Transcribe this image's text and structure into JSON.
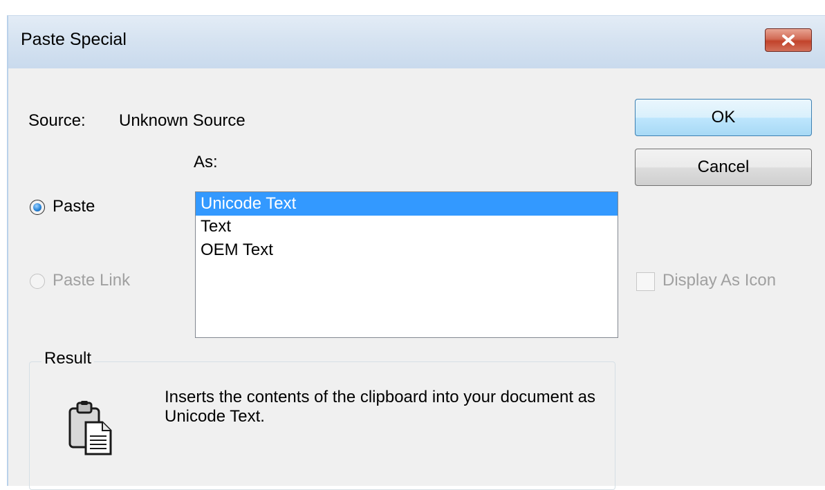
{
  "window": {
    "title": "Paste Special"
  },
  "source": {
    "label": "Source:",
    "value": "Unknown Source"
  },
  "as_label": "As:",
  "options": {
    "paste_label": "Paste",
    "paste_checked": true,
    "paste_link_label": "Paste Link",
    "paste_link_enabled": false
  },
  "formats": {
    "items": [
      "Unicode Text",
      "Text",
      "OEM Text"
    ],
    "selected": "Unicode Text"
  },
  "buttons": {
    "ok_label": "OK",
    "cancel_label": "Cancel"
  },
  "display_as_icon": {
    "label": "Display As Icon",
    "checked": false,
    "enabled": false
  },
  "result": {
    "title": "Result",
    "description": "Inserts the contents of the clipboard into your document as Unicode Text."
  },
  "colors": {
    "selection": "#3399ff",
    "close_button": "#c2432b",
    "title_bar": "#d6e3f1",
    "dialog_bg": "#f0f0f0"
  },
  "icons": {
    "close": "close-icon",
    "result": "clipboard-icon"
  }
}
